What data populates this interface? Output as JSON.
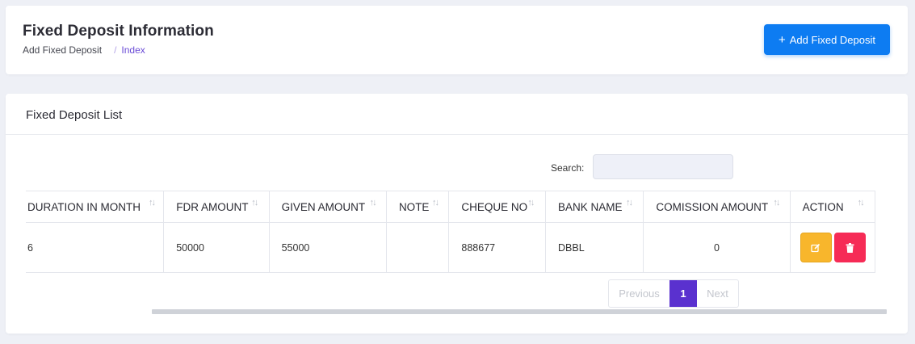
{
  "header": {
    "title": "Fixed Deposit Information",
    "breadcrumb_parent": "Add Fixed Deposit",
    "breadcrumb_sep": "/",
    "breadcrumb_current": "Index",
    "add_button_icon": "+",
    "add_button_label": "Add Fixed Deposit"
  },
  "list": {
    "title": "Fixed Deposit List",
    "search_label": "Search:",
    "search_value": "",
    "sort_icon": "↑↓",
    "columns": [
      "DURATION IN MONTH",
      "FDR AMOUNT",
      "GIVEN AMOUNT",
      "NOTE",
      "CHEQUE NO",
      "BANK NAME",
      "COMISSION AMOUNT",
      "ACTION"
    ],
    "rows": [
      {
        "duration": "6",
        "fdr_amount": "50000",
        "given_amount": "55000",
        "note": "",
        "cheque_no": "888677",
        "bank_name": "DBBL",
        "commission_amount": "0"
      }
    ]
  },
  "pagination": {
    "previous": "Previous",
    "current": "1",
    "next": "Next"
  },
  "colors": {
    "primary": "#0d7cf2",
    "page_active": "#5a31cf",
    "edit": "#f8b62c",
    "delete": "#f62b56"
  }
}
